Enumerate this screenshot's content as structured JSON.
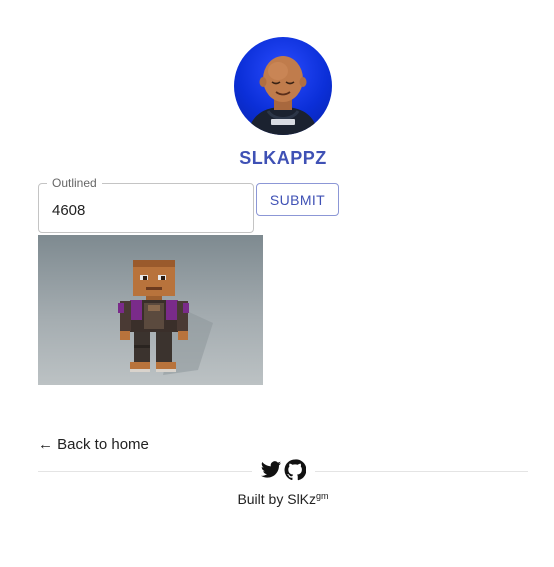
{
  "profile": {
    "name": "SLKAPPZ"
  },
  "form": {
    "field_label": "Outlined",
    "field_value": "4608",
    "submit_label": "SUBMIT"
  },
  "navigation": {
    "back_label": "← Back to home"
  },
  "footer": {
    "built_by": "Built by SlKz",
    "built_by_suffix": "gm",
    "icons": [
      "twitter-icon",
      "github-icon"
    ]
  },
  "colors": {
    "accent": "#3f51b5",
    "avatar_background": "#0b2fd8",
    "divider": "#e4e4e4"
  }
}
